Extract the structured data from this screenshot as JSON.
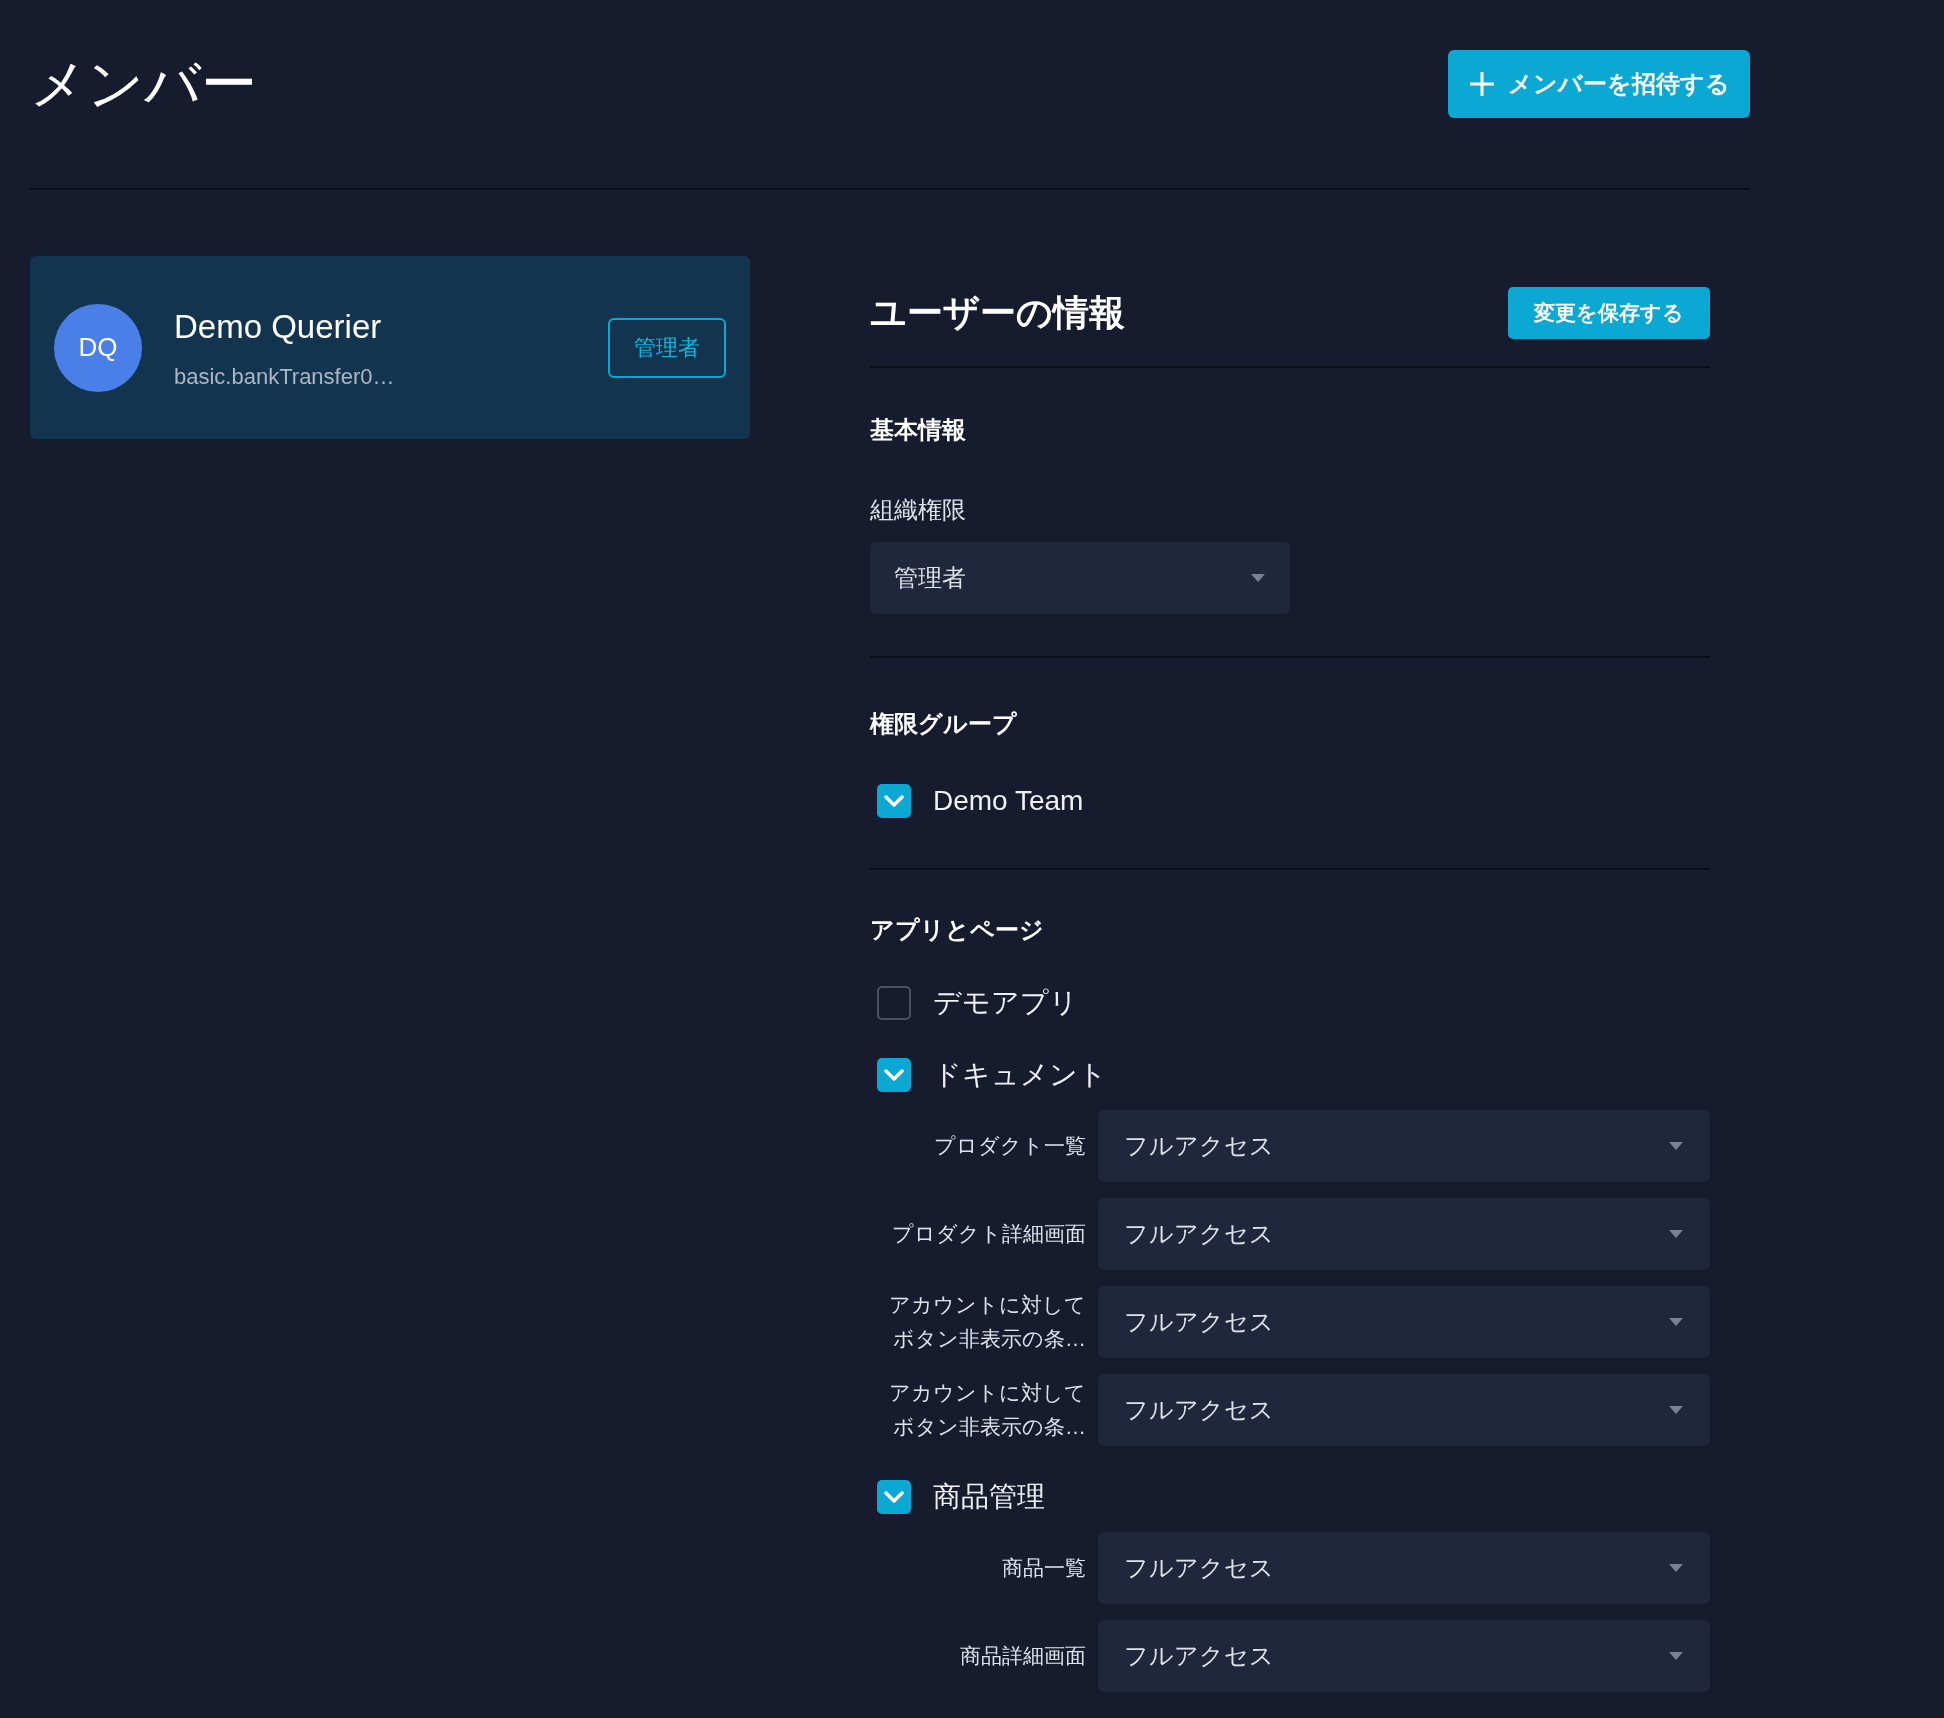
{
  "page": {
    "title": "メンバー",
    "invite_button": "メンバーを招待する"
  },
  "member_card": {
    "initials": "DQ",
    "name": "Demo Querier",
    "email": "basic.bankTransfer0…",
    "role_badge": "管理者"
  },
  "user_info": {
    "title": "ユーザーの情報",
    "save_button": "変更を保存する",
    "basic": {
      "heading": "基本情報",
      "org_role_label": "組織権限",
      "org_role_value": "管理者"
    },
    "groups": {
      "heading": "権限グループ",
      "items": [
        {
          "label": "Demo Team",
          "checked": true
        }
      ]
    },
    "apps": {
      "heading": "アプリとページ",
      "items": [
        {
          "label": "デモアプリ",
          "checked": false
        },
        {
          "label": "ドキュメント",
          "checked": true,
          "pages": [
            {
              "label": "プロダクト一覧",
              "access": "フルアクセス"
            },
            {
              "label": "プロダクト詳細画面",
              "access": "フルアクセス"
            },
            {
              "label": "アカウントに対してボタン非表示の条…",
              "access": "フルアクセス"
            },
            {
              "label": "アカウントに対してボタン非表示の条…",
              "access": "フルアクセス"
            }
          ]
        },
        {
          "label": "商品管理",
          "checked": true,
          "pages": [
            {
              "label": "商品一覧",
              "access": "フルアクセス"
            },
            {
              "label": "商品詳細画面",
              "access": "フルアクセス"
            }
          ]
        }
      ]
    }
  }
}
